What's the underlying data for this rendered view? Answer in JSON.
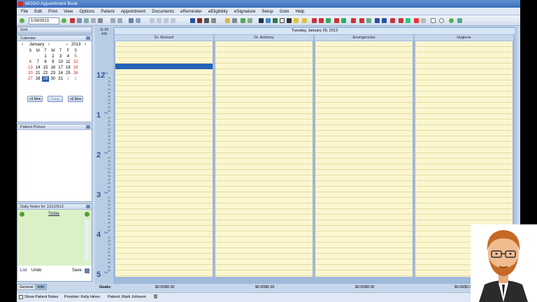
{
  "window": {
    "title": "MOGO Appointment Book"
  },
  "menu": [
    "File",
    "Edit",
    "Print",
    "View",
    "Options",
    "Patient",
    "Appointment",
    "Documents",
    "eReminder",
    "eEligibility",
    "eSignature",
    "Setup",
    "Goto",
    "Help"
  ],
  "toolbar": {
    "date_value": "1/29/2013"
  },
  "left": {
    "top_label": "Grid",
    "calendar": {
      "title": "Calendar",
      "month": "January",
      "year": "2013",
      "weekdays": [
        "S",
        "M",
        "T",
        "W",
        "T",
        "F",
        "S"
      ],
      "weeks": [
        [
          "",
          "",
          "1",
          "2",
          "3",
          "4",
          "5"
        ],
        [
          "6",
          "7",
          "8",
          "9",
          "10",
          "11",
          "12"
        ],
        [
          "13",
          "14",
          "15",
          "16",
          "17",
          "18",
          "19"
        ],
        [
          "20",
          "21",
          "22",
          "23",
          "24",
          "25",
          "26"
        ],
        [
          "27",
          "28",
          "29",
          "30",
          "31",
          "1",
          "2"
        ]
      ],
      "selected_day": "29",
      "btn_minus": "+3 Mon",
      "btn_today": "Today",
      "btn_plus": "+6 Mon"
    },
    "patient_picture": {
      "title": "Patient Picture"
    },
    "daily_notes": {
      "title": "Daily Notes for 1/11/2013",
      "today": "Today",
      "list": "List",
      "undo": "Undo",
      "save": "Save"
    },
    "tabs": [
      "General",
      "Info"
    ]
  },
  "schedule": {
    "current_time": "11:56",
    "current_ampm": "AM",
    "date_header": "Tuesday, January 29, 2013",
    "providers": [
      "Dr. Richard",
      "Dr. Anthony",
      "Emergencies",
      "Hygiene"
    ],
    "hours": [
      {
        "label": "12",
        "ampm": "PM"
      },
      {
        "label": "1",
        "ampm": "PM"
      },
      {
        "label": "2",
        "ampm": "PM"
      },
      {
        "label": "3",
        "ampm": "PM"
      },
      {
        "label": "4",
        "ampm": "PM"
      },
      {
        "label": "5",
        "ampm": "PM"
      }
    ],
    "minute_ticks": [
      "10",
      "15",
      "20",
      "25",
      "30",
      "35",
      "40",
      "45",
      "50",
      "55"
    ],
    "goals_label": "Goals:",
    "goals": [
      "$0.00/$0.00",
      "$0.00/$0.00",
      "$0.00/$0.00",
      "$0.00/$0.00"
    ]
  },
  "status": {
    "show_notes": "Show Patient Notes",
    "provider": "Provider: Kelly Hines",
    "patient": "Patient: Mark Johnson"
  },
  "colors": {
    "appointment": "#2461b7",
    "slot": "#fbf6d0",
    "title_bar": "#3c6fbe"
  }
}
